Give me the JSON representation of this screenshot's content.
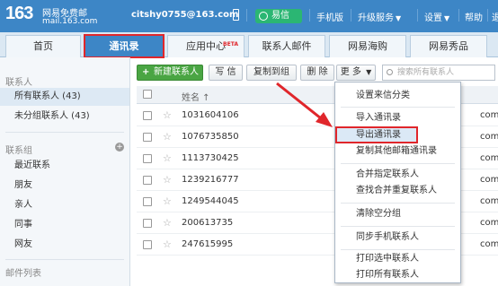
{
  "header": {
    "logo": "163",
    "logo_name": "网易免费邮",
    "logo_domain": "mail.163.com",
    "email": "citshy0755@163.com",
    "yixin_label": "易信",
    "links": [
      "手机版",
      "升级服务",
      "设置",
      "帮助",
      "退"
    ],
    "bg_color": "#3d86c6"
  },
  "tabs": [
    {
      "label": "首页"
    },
    {
      "label": "通讯录",
      "active": true
    },
    {
      "label": "应用中心",
      "badge": "BETA"
    },
    {
      "label": "联系人邮件"
    },
    {
      "label": "网易海购"
    },
    {
      "label": "网易秀品"
    }
  ],
  "sidebar": {
    "contacts_title": "联系人",
    "contacts": [
      {
        "label": "所有联系人 (43)",
        "selected": true
      },
      {
        "label": "未分组联系人 (43)"
      }
    ],
    "groups_title": "联系组",
    "groups": [
      "最近联系",
      "朋友",
      "亲人",
      "同事",
      "网友"
    ],
    "mail_list_title": "邮件列表"
  },
  "toolbar": {
    "new_contact": "新建联系人",
    "write": "写 信",
    "copy_to_group": "复制到组",
    "delete": "删 除",
    "more": "更 多",
    "search_placeholder": "搜索所有联系人"
  },
  "list": {
    "name_header": "姓名 ↑",
    "rows": [
      {
        "name": "1031604106",
        "email_suffix": "com"
      },
      {
        "name": "1076735850",
        "email_suffix": "com"
      },
      {
        "name": "1113730425",
        "email_suffix": "com"
      },
      {
        "name": "1239216777",
        "email_suffix": "com"
      },
      {
        "name": "1249544045",
        "email_suffix": "com"
      },
      {
        "name": "200613735",
        "email_suffix": "com"
      },
      {
        "name": "247615995",
        "email_suffix": "com"
      }
    ]
  },
  "dropdown": {
    "items": [
      {
        "label": "设置来信分类",
        "group": 1
      },
      {
        "label": "导入通讯录",
        "group": 2
      },
      {
        "label": "导出通讯录",
        "group": 2,
        "highlighted": true
      },
      {
        "label": "复制其他邮箱通讯录",
        "group": 2
      },
      {
        "label": "合并指定联系人",
        "group": 3
      },
      {
        "label": "查找合并重复联系人",
        "group": 3
      },
      {
        "label": "清除空分组",
        "group": 4
      },
      {
        "label": "同步手机联系人",
        "group": 5
      },
      {
        "label": "打印选中联系人",
        "group": 6
      },
      {
        "label": "打印所有联系人",
        "group": 6
      }
    ]
  },
  "colors": {
    "accent": "#3d86c6",
    "highlight_border": "#e0262b",
    "new_button": "#4aa543"
  }
}
